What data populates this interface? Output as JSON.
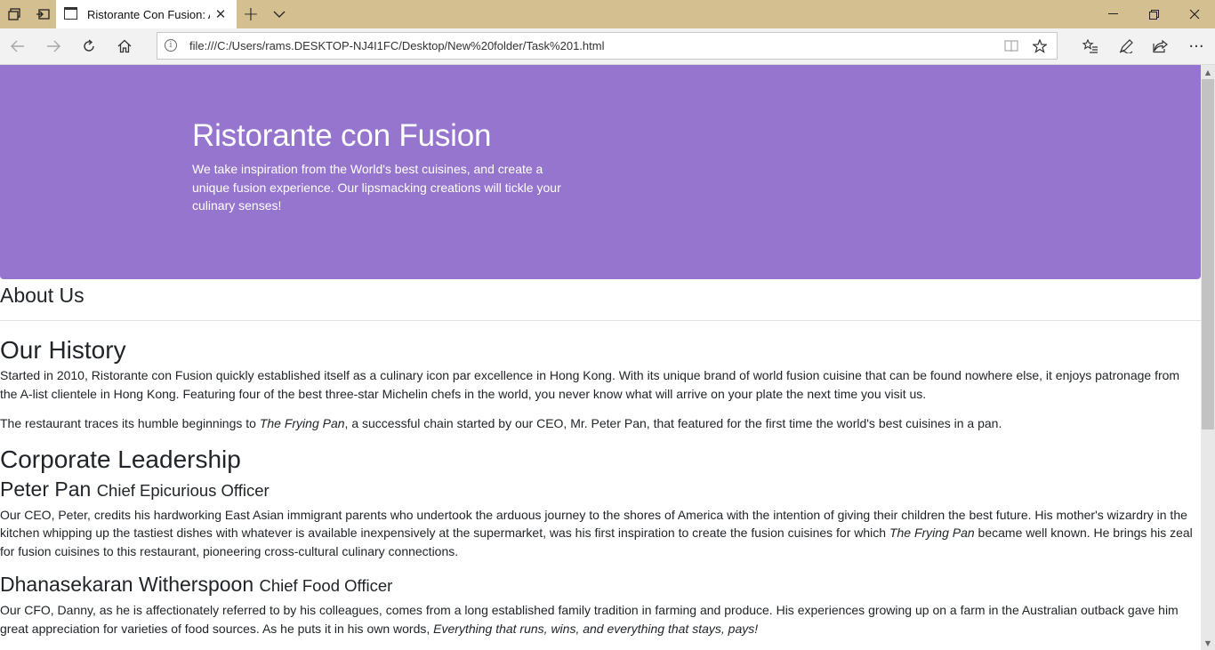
{
  "browser": {
    "tab_title": "Ristorante Con Fusion: About Us",
    "url": "file:///C:/Users/rams.DESKTOP-NJ4I1FC/Desktop/New%20folder/Task%201.html",
    "icons": {
      "tab_manager": "tab-manager-icon",
      "set_aside": "set-aside-tabs-icon",
      "new_tab": "plus-icon",
      "tab_dropdown": "chevron-down-icon",
      "minimize": "minimize-icon",
      "restore": "restore-icon",
      "close": "close-icon",
      "back": "back-arrow-icon",
      "forward": "forward-arrow-icon",
      "refresh": "refresh-icon",
      "home": "home-icon",
      "reading_view": "reading-view-icon",
      "favorite": "star-icon",
      "favorites_hub": "favorites-list-icon",
      "web_note": "pen-icon",
      "share": "share-icon",
      "more": "ellipsis-icon"
    }
  },
  "jumbotron": {
    "title": "Ristorante con Fusion",
    "text": "We take inspiration from the World's best cuisines, and create a unique fusion experience. Our lipsmacking creations will tickle your culinary senses!",
    "background": "#9575cd"
  },
  "page": {
    "about_title": "About Us",
    "history_title": "Our History",
    "history_p1": "Started in 2010, Ristorante con Fusion quickly established itself as a culinary icon par excellence in Hong Kong. With its unique brand of world fusion cuisine that can be found nowhere else, it enjoys patronage from the A-list clientele in Hong Kong. Featuring four of the best three-star Michelin chefs in the world, you never know what will arrive on your plate the next time you visit us.",
    "history_p2_before": "The restaurant traces its humble beginnings to ",
    "history_p2_em": "The Frying Pan",
    "history_p2_after": ", a successful chain started by our CEO, Mr. Peter Pan, that featured for the first time the world's best cuisines in a pan.",
    "leadership_title": "Corporate Leadership",
    "leaders": [
      {
        "name": "Peter Pan",
        "role": "Chief Epicurious Officer",
        "bio_before": "Our CEO, Peter, credits his hardworking East Asian immigrant parents who undertook the arduous journey to the shores of America with the intention of giving their children the best future. His mother's wizardry in the kitchen whipping up the tastiest dishes with whatever is available inexpensively at the supermarket, was his first inspiration to create the fusion cuisines for which ",
        "bio_em": "The Frying Pan",
        "bio_after": " became well known. He brings his zeal for fusion cuisines to this restaurant, pioneering cross-cultural culinary connections."
      },
      {
        "name": "Dhanasekaran Witherspoon",
        "role": "Chief Food Officer",
        "bio_before": "Our CFO, Danny, as he is affectionately referred to by his colleagues, comes from a long established family tradition in farming and produce. His experiences growing up on a farm in the Australian outback gave him great appreciation for varieties of food sources. As he puts it in his own words, ",
        "bio_em": "Everything that runs, wins, and everything that stays, pays!",
        "bio_after": ""
      }
    ]
  }
}
